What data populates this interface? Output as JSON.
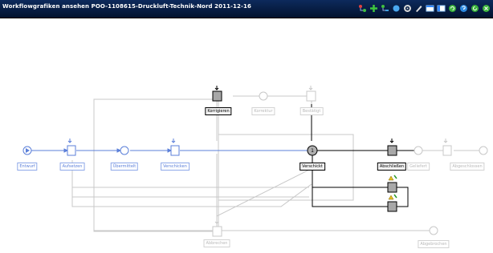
{
  "window": {
    "title": "Workflowgrafiken ansehen POO-1108615-Druckluft-Technik-Nord 2011-12-16"
  },
  "toolbar": {
    "icons": [
      "tree-add-icon",
      "plus-icon",
      "tree-remove-icon",
      "circle-icon",
      "gear-icon",
      "pencil-icon",
      "window-icon",
      "layout-icon",
      "refresh-icon",
      "help-icon",
      "refresh2-icon",
      "close-icon"
    ]
  },
  "workflow": {
    "nodes": {
      "entwurf": "Entwurf",
      "aufsetzen": "Aufsetzen",
      "uebermittelt": "Übermittelt",
      "verschicken": "Verschicken",
      "korrigieren": "Korrigieren",
      "korrektur": "Korrektur",
      "bestaetigt": "Bestätigt",
      "verschickt": "Verschickt",
      "verschickt_badge": "1",
      "abschliessen": "Abschließen",
      "geliefert": "Geliefert",
      "abgeschlossen": "Abgeschlossen",
      "abbrechen": "Abbrechen",
      "abgebrochen": "Abgebrochen"
    }
  }
}
